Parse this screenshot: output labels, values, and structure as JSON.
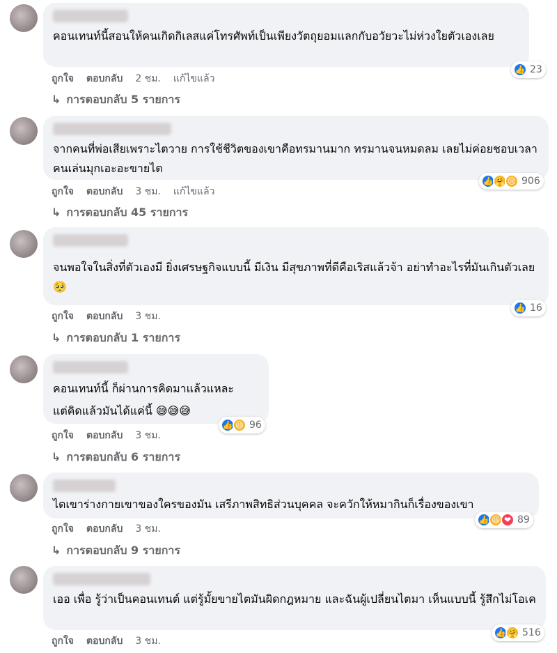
{
  "comments": [
    {
      "text": "คอนเทนท์นี้สอนให้คนเกิดกิเลสแค่โทรศัพท์เป็นเพียงวัตถุยอมแลกกับอวัยวะไม่ห่วงใยตัวเองเลย",
      "like": "ถูกใจ",
      "reply": "ตอบกลับ",
      "time": "2 ชม.",
      "edited": "แก้ไขแล้ว",
      "reactions": [
        "like"
      ],
      "count": "23",
      "replies": "การตอบกลับ 5 รายการ"
    },
    {
      "text": "จากคนที่พ่อเสียเพราะไตวาย การใช้ชีวิตของเขาคือทรมานมาก ทรมานจนหมดลม เลยไม่ค่อยชอบเวลาคนเล่นมุกเอะอะขายไต",
      "like": "ถูกใจ",
      "reply": "ตอบกลับ",
      "time": "3 ชม.",
      "edited": "แก้ไขแล้ว",
      "reactions": [
        "like",
        "care",
        "sad"
      ],
      "count": "906",
      "replies": "การตอบกลับ 45 รายการ"
    },
    {
      "text": "จนพอใจในสิ่งที่ตัวเองมี ยิ่งเศรษฐกิจแบบนี้ มีเงิน มีสุขภาพที่ดีคือเริสแล้วจ้า อย่าทำอะไรที่มันเกินตัวเลย 🥺",
      "like": "ถูกใจ",
      "reply": "ตอบกลับ",
      "time": "3 ชม.",
      "edited": "",
      "reactions": [
        "like"
      ],
      "count": "16",
      "replies": "การตอบกลับ 1 รายการ"
    },
    {
      "text": "คอนเทนท์นี้ ก็ผ่านการคิดมาแล้วแหละ\nแต่คิดแล้วมันได้แค่นี้ 😅😅😅",
      "like": "ถูกใจ",
      "reply": "ตอบกลับ",
      "time": "3 ชม.",
      "edited": "",
      "reactions": [
        "like",
        "haha"
      ],
      "count": "96",
      "replies": "การตอบกลับ 6 รายการ"
    },
    {
      "text": "ไตเขาร่างกายเขาของใครของมัน เสรีภาพสิทธิส่วนบุคคล จะควักให้หมากินก็เรื่องของเขา",
      "like": "ถูกใจ",
      "reply": "ตอบกลับ",
      "time": "3 ชม.",
      "edited": "",
      "reactions": [
        "like",
        "haha",
        "love"
      ],
      "count": "89",
      "replies": "การตอบกลับ 9 รายการ"
    },
    {
      "text": "เออ เพื่อ รู้ว่าเป็นคอนเทนต์ แต่รู้มั้ยขายไตมันผิดกฎหมาย และฉันผู้เปลี่ยนไตมา เห็นแบบนี้ รู้สึกไม่โอเค",
      "like": "ถูกใจ",
      "reply": "ตอบกลับ",
      "time": "3 ชม.",
      "edited": "",
      "reactions": [
        "like",
        "care"
      ],
      "count": "516",
      "replies": ""
    }
  ]
}
